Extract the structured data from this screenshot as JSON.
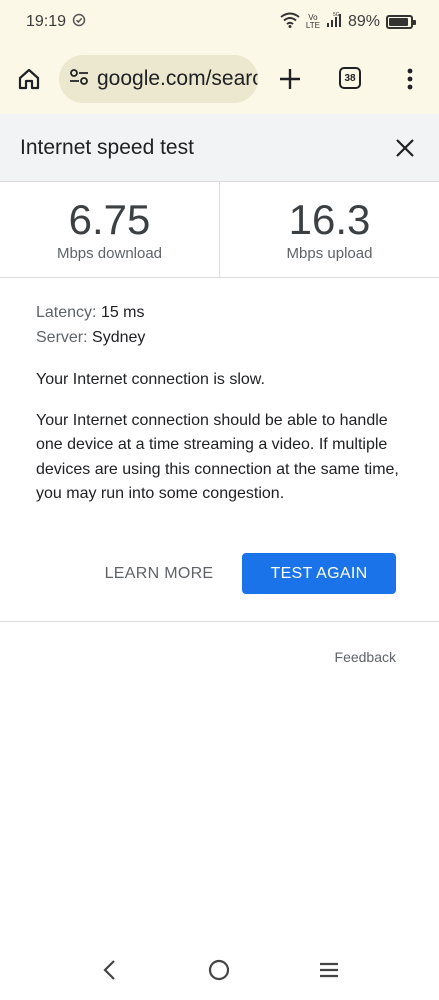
{
  "status": {
    "time": "19:19",
    "volte": "Vo\nLTE",
    "network": "5G",
    "battery": "89%"
  },
  "browser": {
    "url": "google.com/searc",
    "tab_count": "38"
  },
  "speed_test": {
    "title": "Internet speed test",
    "download_value": "6.75",
    "download_unit": "Mbps download",
    "upload_value": "16.3",
    "upload_unit": "Mbps upload",
    "latency_label": "Latency:",
    "latency_value": "15 ms",
    "server_label": "Server:",
    "server_value": "Sydney",
    "summary": "Your Internet connection is slow.",
    "description": "Your Internet connection should be able to handle one device at a time streaming a video. If multiple devices are using this connection at the same time, you may run into some congestion.",
    "learn_more_label": "LEARN MORE",
    "test_again_label": "TEST AGAIN",
    "feedback_label": "Feedback"
  },
  "colors": {
    "accent": "#1a73e8",
    "toolbar_bg": "#fbf8e8"
  }
}
